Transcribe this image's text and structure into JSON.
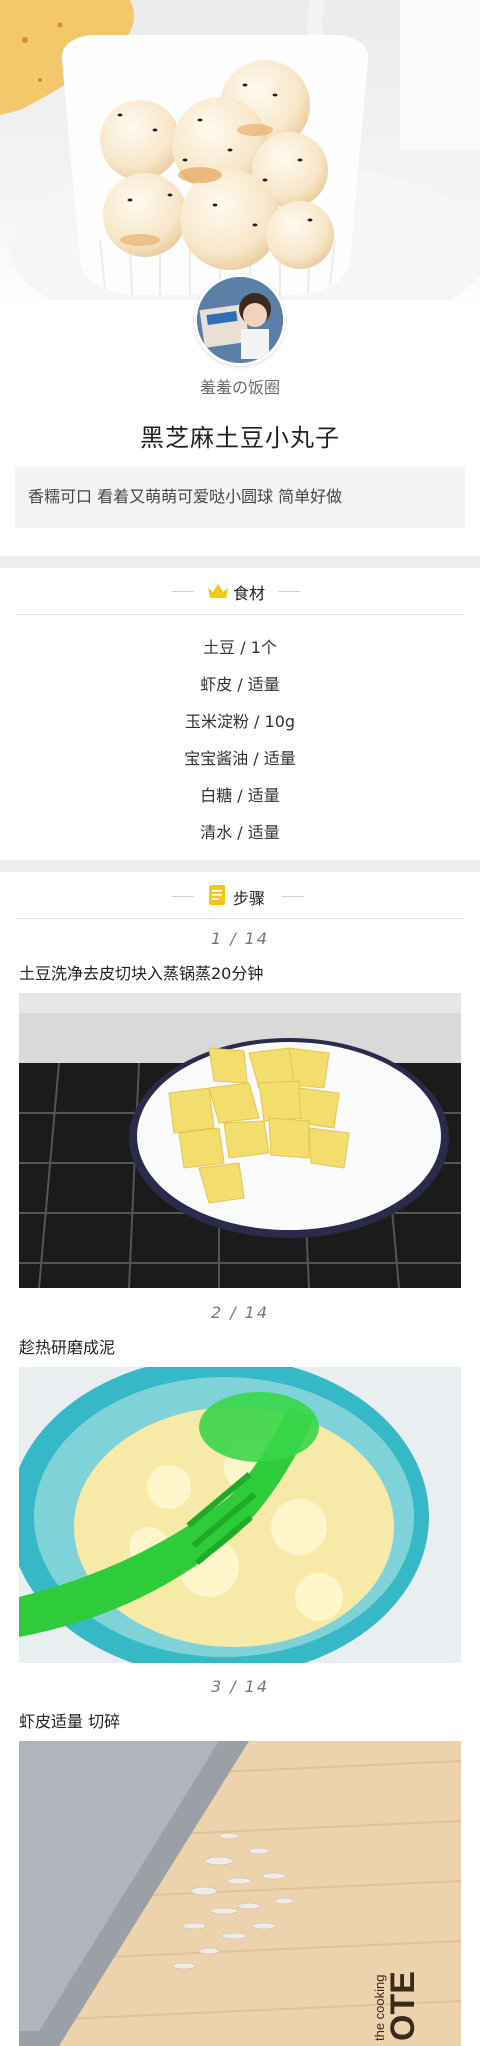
{
  "recipe": {
    "author": "羞羞の饭圈",
    "title": "黑芝麻土豆小丸子",
    "description": "香糯可口 看着又萌萌可爱哒小圆球 简单好做"
  },
  "ingredients": {
    "heading": "食材",
    "items": [
      {
        "text": "土豆 / 1个"
      },
      {
        "text": "虾皮 / 适量"
      },
      {
        "text": "玉米淀粉 / 10g"
      },
      {
        "text": "宝宝酱油 / 适量"
      },
      {
        "text": "白糖 / 适量"
      },
      {
        "text": "清水 / 适量"
      }
    ]
  },
  "steps": {
    "heading": "步骤",
    "items": [
      {
        "index": "1  /  14",
        "text": "土豆洗净去皮切块入蒸锅蒸20分钟"
      },
      {
        "index": "2  /  14",
        "text": "趁热研磨成泥"
      },
      {
        "index": "3  /  14",
        "text": "虾皮适量 切碎"
      }
    ]
  },
  "image_text": {
    "board_brand": "OTE",
    "board_tagline": "the cooking"
  },
  "colors": {
    "accent_yellow": "#f5c518",
    "section_gap": "#eeeeee",
    "desc_bg": "#f4f4f4"
  },
  "icons": {
    "ingredients": "crown-icon",
    "steps": "note-icon"
  }
}
